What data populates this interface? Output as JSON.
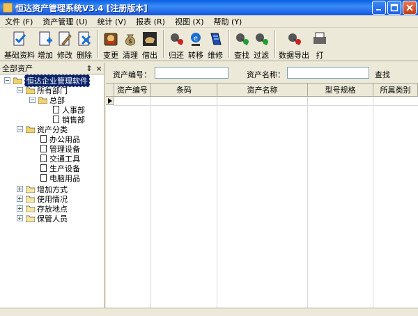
{
  "window": {
    "title": "恒达资产管理系统V3.4 [注册版本]"
  },
  "menu": [
    {
      "label": "文件 (F)"
    },
    {
      "label": "资产管理 (U)"
    },
    {
      "label": "统计 (V)"
    },
    {
      "label": "报表 (R)"
    },
    {
      "label": "视图 (X)"
    },
    {
      "label": "帮助 (Y)"
    }
  ],
  "toolbar": [
    {
      "label": "基础资料",
      "icon": "check-doc-icon"
    },
    {
      "label": "增加",
      "icon": "add-doc-icon"
    },
    {
      "label": "修改",
      "icon": "edit-doc-icon"
    },
    {
      "label": "删除",
      "icon": "delete-doc-icon"
    },
    {
      "label": "变更",
      "icon": "change-icon"
    },
    {
      "label": "清理",
      "icon": "money-bag-icon"
    },
    {
      "label": "借出",
      "icon": "lend-icon"
    },
    {
      "label": "归还",
      "icon": "return-icon"
    },
    {
      "label": "转移",
      "icon": "transfer-icon"
    },
    {
      "label": "维修",
      "icon": "repair-icon"
    },
    {
      "label": "查找",
      "icon": "find-icon"
    },
    {
      "label": "过滤",
      "icon": "filter-icon"
    },
    {
      "label": "数据导出",
      "icon": "export-icon"
    },
    {
      "label": "打",
      "icon": "print-icon"
    }
  ],
  "left_panel": {
    "title": "全部资产",
    "pin": "⇕",
    "close": "×",
    "tree": [
      {
        "label": "恒达企业管理软件"
      },
      {
        "label": "所有部门"
      },
      {
        "label": "总部"
      },
      {
        "label": "人事部"
      },
      {
        "label": "销售部"
      },
      {
        "label": "资产分类"
      },
      {
        "label": "办公用品"
      },
      {
        "label": "管理设备"
      },
      {
        "label": "交通工具"
      },
      {
        "label": "生产设备"
      },
      {
        "label": "电脑用品"
      },
      {
        "label": "增加方式"
      },
      {
        "label": "使用情况"
      },
      {
        "label": "存放地点"
      },
      {
        "label": "保管人员"
      }
    ]
  },
  "search": {
    "asset_no_label": "资产编号：",
    "asset_no_value": "",
    "asset_name_label": "资产名称：",
    "asset_name_value": "",
    "find_label": "查找"
  },
  "grid": {
    "columns": [
      "资产编号",
      "条码",
      "资产名称",
      "型号规格",
      "所属类别"
    ]
  },
  "colors": {
    "title_bar": "#1556e0",
    "selection": "#0a246a",
    "face": "#ece9d8"
  }
}
